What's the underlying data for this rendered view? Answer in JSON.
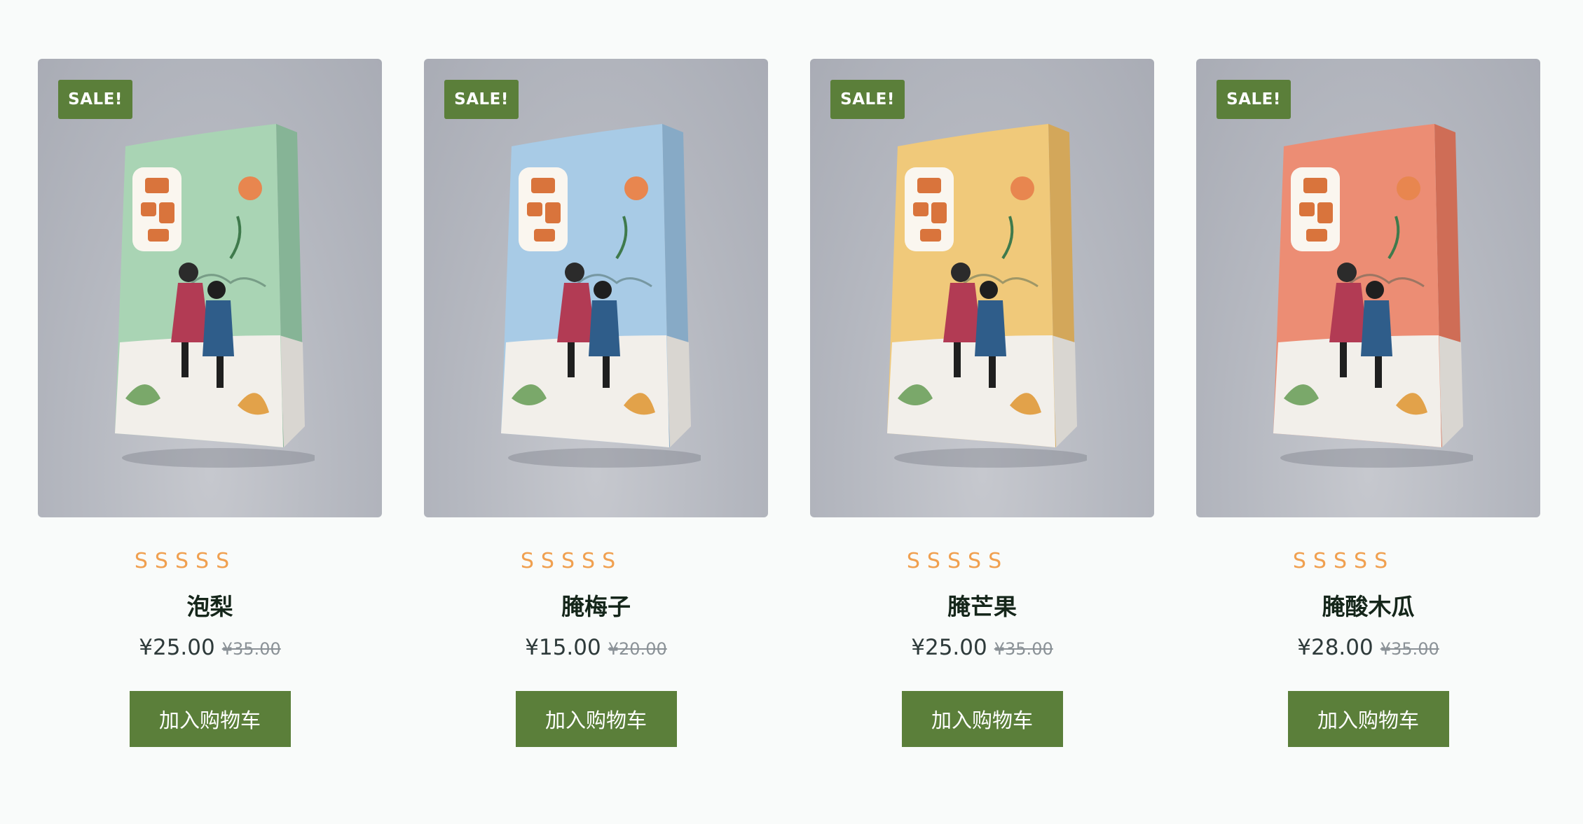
{
  "products": [
    {
      "badge": "SALE!",
      "stars": [
        "S",
        "S",
        "S",
        "S",
        "S"
      ],
      "name": "泡梨",
      "price": "¥25.00",
      "old_price": "¥35.00",
      "button": "加入购物车",
      "bag_color": "#a9d4b4",
      "bag_dark": "#86b496",
      "bag_icon": "product-bag-image"
    },
    {
      "badge": "SALE!",
      "stars": [
        "S",
        "S",
        "S",
        "S",
        "S"
      ],
      "name": "腌梅子",
      "price": "¥15.00",
      "old_price": "¥20.00",
      "button": "加入购物车",
      "bag_color": "#a8cbe6",
      "bag_dark": "#87aac6",
      "bag_icon": "product-bag-image"
    },
    {
      "badge": "SALE!",
      "stars": [
        "S",
        "S",
        "S",
        "S",
        "S"
      ],
      "name": "腌芒果",
      "price": "¥25.00",
      "old_price": "¥35.00",
      "button": "加入购物车",
      "bag_color": "#f0c97a",
      "bag_dark": "#d3a75a",
      "bag_icon": "product-bag-image"
    },
    {
      "badge": "SALE!",
      "stars": [
        "S",
        "S",
        "S",
        "S",
        "S"
      ],
      "name": "腌酸木瓜",
      "price": "¥28.00",
      "old_price": "¥35.00",
      "button": "加入购物车",
      "bag_color": "#ec8d74",
      "bag_dark": "#cf6d56",
      "bag_icon": "product-bag-image"
    }
  ],
  "colors": {
    "accent": "#5b7f3a",
    "star": "#f0a050",
    "text_dark": "#15261a",
    "old_price": "#8b9297"
  }
}
